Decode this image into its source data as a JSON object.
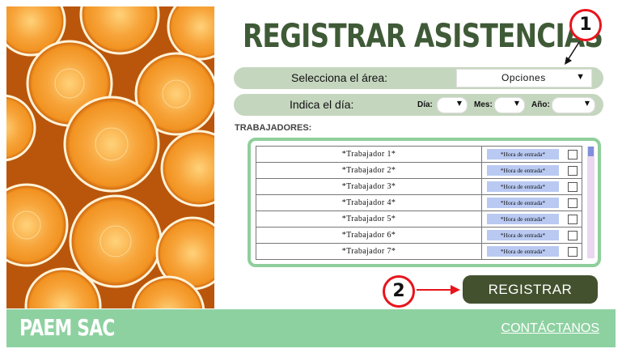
{
  "header": {
    "title": "REGISTRAR ASISTENCIAS"
  },
  "area": {
    "label": "Selecciona el área:",
    "selected": "Opciones"
  },
  "date": {
    "label": "Indica el día:",
    "day_label": "Día:",
    "month_label": "Mes:",
    "year_label": "Año:"
  },
  "workers": {
    "section_label": "TRABAJADORES:",
    "rows": [
      {
        "name": "*Trabajador 1*",
        "time": "*Hora de entrada*"
      },
      {
        "name": "*Trabajador 2*",
        "time": "*Hora de entrada*"
      },
      {
        "name": "*Trabajador 3*",
        "time": "*Hora de entrada*"
      },
      {
        "name": "*Trabajador 4*",
        "time": "*Hora de entrada*"
      },
      {
        "name": "*Trabajador 5*",
        "time": "*Hora de entrada*"
      },
      {
        "name": "*Trabajador 6*",
        "time": "*Hora de entrada*"
      },
      {
        "name": "*Trabajador 7*",
        "time": "*Hora de entrada*"
      }
    ]
  },
  "actions": {
    "register_label": "REGISTRAR"
  },
  "callouts": {
    "one": "1",
    "two": "2"
  },
  "footer": {
    "brand": "PAEM SAC",
    "contact_label": "CONTÁCTANOS"
  },
  "colors": {
    "title": "#3f5a36",
    "pill": "#c5d6bf",
    "table_border": "#8fcf9b",
    "button": "#43512f",
    "footer": "#8ed1a1",
    "callout": "#e8141c"
  },
  "icons": {
    "dropdown": "caret-down-icon",
    "arrow": "red-arrow-icon"
  }
}
